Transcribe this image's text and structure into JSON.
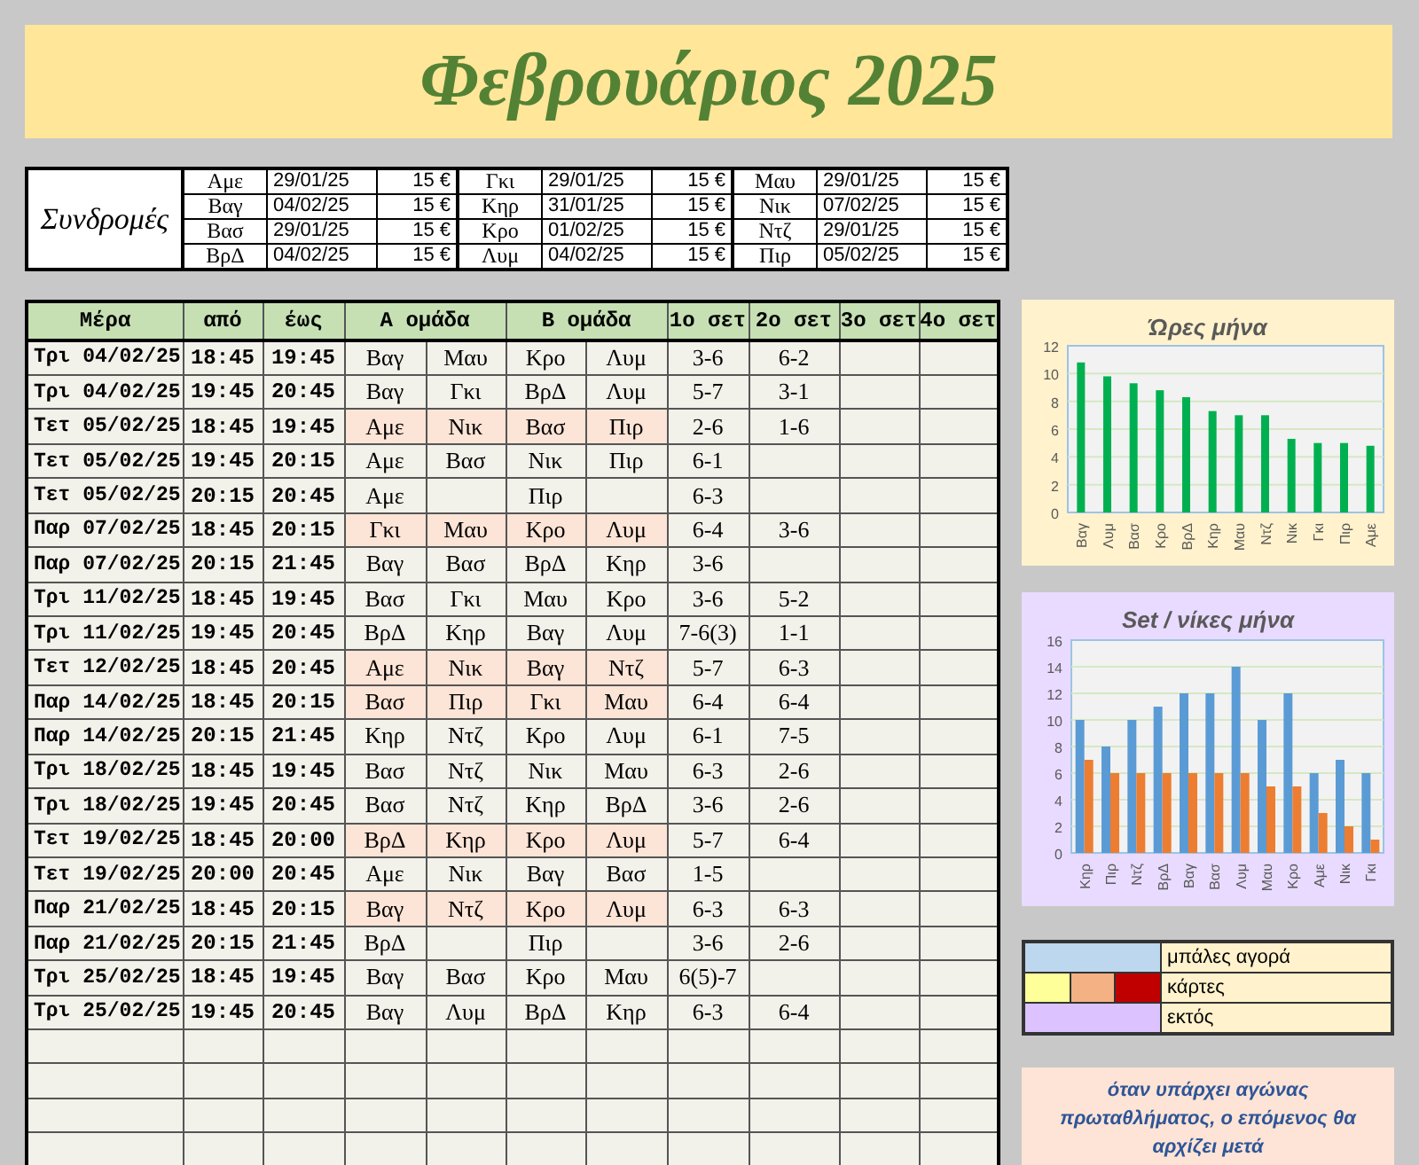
{
  "title": "Φεβρουάριος 2025",
  "subscriptions": {
    "label": "Συνδρομές",
    "groups": [
      [
        {
          "name": "Αμε",
          "date": "29/01/25",
          "price": "15 €"
        },
        {
          "name": "Βαγ",
          "date": "04/02/25",
          "price": "15 €"
        },
        {
          "name": "Βασ",
          "date": "29/01/25",
          "price": "15 €"
        },
        {
          "name": "ΒρΔ",
          "date": "04/02/25",
          "price": "15 €"
        }
      ],
      [
        {
          "name": "Γκι",
          "date": "29/01/25",
          "price": "15 €"
        },
        {
          "name": "Κηρ",
          "date": "31/01/25",
          "price": "15 €"
        },
        {
          "name": "Κρο",
          "date": "01/02/25",
          "price": "15 €"
        },
        {
          "name": "Λυμ",
          "date": "04/02/25",
          "price": "15 €"
        }
      ],
      [
        {
          "name": "Μαυ",
          "date": "29/01/25",
          "price": "15 €"
        },
        {
          "name": "Νικ",
          "date": "07/02/25",
          "price": "15 €"
        },
        {
          "name": "Ντζ",
          "date": "29/01/25",
          "price": "15 €"
        },
        {
          "name": "Πιρ",
          "date": "05/02/25",
          "price": "15 €"
        }
      ]
    ]
  },
  "schedule": {
    "columns": [
      "Μέρα",
      "από",
      "έως",
      "Α ομάδα",
      "Β ομάδα",
      "1ο σετ",
      "2ο σετ",
      "3ο σετ",
      "4ο σετ"
    ],
    "rows": [
      {
        "day": "Τρι 04/02/25",
        "from": "18:45",
        "to": "19:45",
        "a_team": [
          "Βαγ",
          "Μαυ"
        ],
        "b_team": [
          "Κρο",
          "Λυμ"
        ],
        "sets": [
          "3-6",
          "6-2"
        ],
        "highlighted": false
      },
      {
        "day": "Τρι 04/02/25",
        "from": "19:45",
        "to": "20:45",
        "a_team": [
          "Βαγ",
          "Γκι"
        ],
        "b_team": [
          "ΒρΔ",
          "Λυμ"
        ],
        "sets": [
          "5-7",
          "3-1"
        ],
        "highlighted": false
      },
      {
        "day": "Τετ 05/02/25",
        "from": "18:45",
        "to": "19:45",
        "a_team": [
          "Αμε",
          "Νικ"
        ],
        "b_team": [
          "Βασ",
          "Πιρ"
        ],
        "sets": [
          "2-6",
          "1-6"
        ],
        "highlighted": true
      },
      {
        "day": "Τετ 05/02/25",
        "from": "19:45",
        "to": "20:15",
        "a_team": [
          "Αμε",
          "Βασ"
        ],
        "b_team": [
          "Νικ",
          "Πιρ"
        ],
        "sets": [
          "6-1"
        ],
        "highlighted": false
      },
      {
        "day": "Τετ 05/02/25",
        "from": "20:15",
        "to": "20:45",
        "a_team": [
          "Αμε"
        ],
        "b_team": [
          "Πιρ"
        ],
        "sets": [
          "6-3"
        ],
        "highlighted": false
      },
      {
        "day": "Παρ 07/02/25",
        "from": "18:45",
        "to": "20:15",
        "a_team": [
          "Γκι",
          "Μαυ"
        ],
        "b_team": [
          "Κρο",
          "Λυμ"
        ],
        "sets": [
          "6-4",
          "3-6"
        ],
        "highlighted": true
      },
      {
        "day": "Παρ 07/02/25",
        "from": "20:15",
        "to": "21:45",
        "a_team": [
          "Βαγ",
          "Βασ"
        ],
        "b_team": [
          "ΒρΔ",
          "Κηρ"
        ],
        "sets": [
          "3-6"
        ],
        "highlighted": false
      },
      {
        "day": "Τρι 11/02/25",
        "from": "18:45",
        "to": "19:45",
        "a_team": [
          "Βασ",
          "Γκι"
        ],
        "b_team": [
          "Μαυ",
          "Κρο"
        ],
        "sets": [
          "3-6",
          "5-2"
        ],
        "highlighted": false
      },
      {
        "day": "Τρι 11/02/25",
        "from": "19:45",
        "to": "20:45",
        "a_team": [
          "ΒρΔ",
          "Κηρ"
        ],
        "b_team": [
          "Βαγ",
          "Λυμ"
        ],
        "sets": [
          "7-6(3)",
          "1-1"
        ],
        "highlighted": false
      },
      {
        "day": "Τετ 12/02/25",
        "from": "18:45",
        "to": "20:45",
        "a_team": [
          "Αμε",
          "Νικ"
        ],
        "b_team": [
          "Βαγ",
          "Ντζ"
        ],
        "sets": [
          "5-7",
          "6-3"
        ],
        "highlighted": true
      },
      {
        "day": "Παρ 14/02/25",
        "from": "18:45",
        "to": "20:15",
        "a_team": [
          "Βασ",
          "Πιρ"
        ],
        "b_team": [
          "Γκι",
          "Μαυ"
        ],
        "sets": [
          "6-4",
          "6-4"
        ],
        "highlighted": true
      },
      {
        "day": "Παρ 14/02/25",
        "from": "20:15",
        "to": "21:45",
        "a_team": [
          "Κηρ",
          "Ντζ"
        ],
        "b_team": [
          "Κρο",
          "Λυμ"
        ],
        "sets": [
          "6-1",
          "7-5"
        ],
        "highlighted": false
      },
      {
        "day": "Τρι 18/02/25",
        "from": "18:45",
        "to": "19:45",
        "a_team": [
          "Βασ",
          "Ντζ"
        ],
        "b_team": [
          "Νικ",
          "Μαυ"
        ],
        "sets": [
          "6-3",
          "2-6"
        ],
        "highlighted": false
      },
      {
        "day": "Τρι 18/02/25",
        "from": "19:45",
        "to": "20:45",
        "a_team": [
          "Βασ",
          "Ντζ"
        ],
        "b_team": [
          "Κηρ",
          "ΒρΔ"
        ],
        "sets": [
          "3-6",
          "2-6"
        ],
        "highlighted": false
      },
      {
        "day": "Τετ 19/02/25",
        "from": "18:45",
        "to": "20:00",
        "a_team": [
          "ΒρΔ",
          "Κηρ"
        ],
        "b_team": [
          "Κρο",
          "Λυμ"
        ],
        "sets": [
          "5-7",
          "6-4"
        ],
        "highlighted": true
      },
      {
        "day": "Τετ 19/02/25",
        "from": "20:00",
        "to": "20:45",
        "a_team": [
          "Αμε",
          "Νικ"
        ],
        "b_team": [
          "Βαγ",
          "Βασ"
        ],
        "sets": [
          "1-5"
        ],
        "highlighted": false
      },
      {
        "day": "Παρ 21/02/25",
        "from": "18:45",
        "to": "20:15",
        "a_team": [
          "Βαγ",
          "Ντζ"
        ],
        "b_team": [
          "Κρο",
          "Λυμ"
        ],
        "sets": [
          "6-3",
          "6-3"
        ],
        "highlighted": true
      },
      {
        "day": "Παρ 21/02/25",
        "from": "20:15",
        "to": "21:45",
        "a_team": [
          "ΒρΔ"
        ],
        "b_team": [
          "Πιρ"
        ],
        "sets": [
          "3-6",
          "2-6"
        ],
        "highlighted": false
      },
      {
        "day": "Τρι 25/02/25",
        "from": "18:45",
        "to": "19:45",
        "a_team": [
          "Βαγ",
          "Βασ"
        ],
        "b_team": [
          "Κρο",
          "Μαυ"
        ],
        "sets": [
          "6(5)-7"
        ],
        "highlighted": false
      },
      {
        "day": "Τρι 25/02/25",
        "from": "19:45",
        "to": "20:45",
        "a_team": [
          "Βαγ",
          "Λυμ"
        ],
        "b_team": [
          "ΒρΔ",
          "Κηρ"
        ],
        "sets": [
          "6-3",
          "6-4"
        ],
        "highlighted": false
      }
    ]
  },
  "hours_chart": {
    "chart_data": {
      "type": "bar",
      "title": "Ώρες μήνα",
      "categories": [
        "Βαγ",
        "Λυμ",
        "Βασ",
        "Κρο",
        "ΒρΔ",
        "Κηρ",
        "Μαυ",
        "Ντζ",
        "Νικ",
        "Γκι",
        "Πιρ",
        "Αμε"
      ],
      "series": [
        {
          "color": "#00b050",
          "values": [
            10.8,
            9.8,
            9.3,
            8.8,
            8.3,
            7.3,
            7,
            7,
            5.3,
            5,
            5,
            4.8
          ]
        }
      ],
      "grid": true,
      "ylim": [
        0,
        12
      ],
      "yticks": [
        0,
        2,
        4,
        6,
        8,
        10,
        12
      ]
    }
  },
  "sets_chart": {
    "chart_data": {
      "type": "bar",
      "title": "Set / νίκες μήνα",
      "categories": [
        "Κηρ",
        "Πιρ",
        "Ντζ",
        "ΒρΔ",
        "Βαγ",
        "Βασ",
        "Λυμ",
        "Μαυ",
        "Κρο",
        "Αμε",
        "Νικ",
        "Γκι"
      ],
      "series": [
        {
          "color": "#5b9bd5",
          "values": [
            10,
            8,
            10,
            11,
            12,
            12,
            14,
            10,
            12,
            6,
            7,
            6
          ]
        },
        {
          "color": "#ed7d31",
          "values": [
            7,
            6,
            6,
            6,
            6,
            6,
            6,
            5,
            5,
            3,
            2,
            1
          ]
        }
      ],
      "grid": true,
      "ylim": [
        0,
        16
      ],
      "yticks": [
        0,
        2,
        4,
        6,
        8,
        10,
        12,
        14,
        16
      ]
    }
  },
  "legend": [
    {
      "swatches": [
        {
          "color": "#bdd7ee"
        }
      ],
      "label": "μπάλες αγορά"
    },
    {
      "swatches": [
        {
          "color": "#ffff99"
        },
        {
          "color": "#f4b183"
        },
        {
          "color": "#c00000"
        }
      ],
      "label": "κάρτες"
    },
    {
      "swatches": [
        {
          "color": "#dcc3ff"
        }
      ],
      "label": "εκτός"
    }
  ],
  "note": "όταν υπάρχει αγώνας πρωταθλήματος, ο επόμενος θα αρχίζει μετά"
}
